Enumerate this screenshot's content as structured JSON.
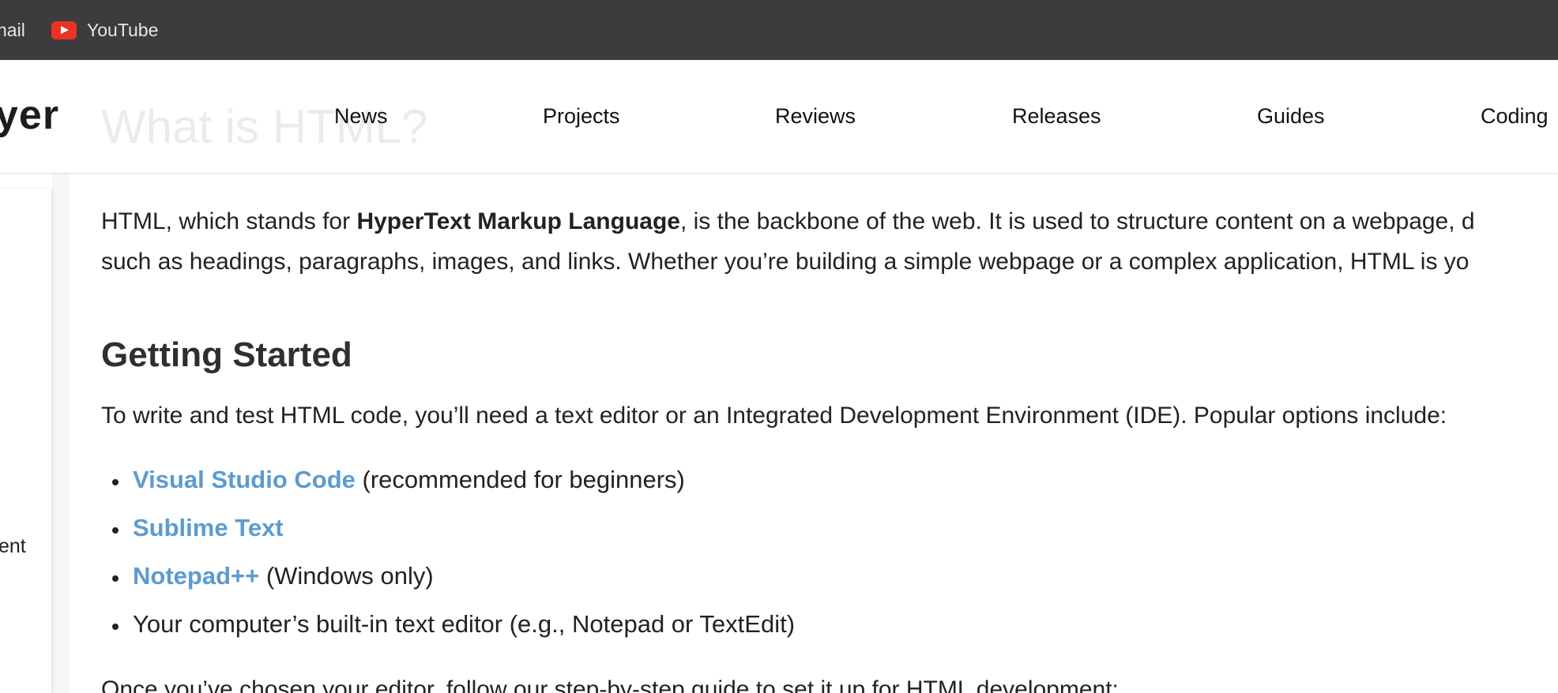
{
  "bookmarks": {
    "items": [
      {
        "label": "Gmail",
        "icon": "gmail-icon"
      },
      {
        "label": "YouTube",
        "icon": "youtube-icon"
      }
    ],
    "visible_gmail_fragment": "nail"
  },
  "header": {
    "logo_text": "yer",
    "ghost_title": "What is HTML?",
    "nav": [
      "News",
      "Projects",
      "Reviews",
      "Releases",
      "Guides",
      "Coding"
    ]
  },
  "sidebar": {
    "item_fragment": "ent"
  },
  "article": {
    "intro_part1": "HTML, which stands for ",
    "intro_bold": "HyperText Markup Language",
    "intro_part2": ", is the backbone of the web. It is used to structure content on a webpage, d",
    "intro_line2": "such as headings, paragraphs, images, and links. Whether you’re building a simple webpage or a complex application, HTML is yo",
    "heading": "Getting Started",
    "lead": "To write and test HTML code, you’ll need a text editor or an Integrated Development Environment (IDE). Popular options include:",
    "editors": [
      {
        "name": "Visual Studio Code",
        "note": " (recommended for beginners)"
      },
      {
        "name": "Sublime Text",
        "note": ""
      },
      {
        "name": "Notepad++",
        "note": " (Windows only)"
      }
    ],
    "builtin_editor": "Your computer’s built-in text editor (e.g., Notepad or TextEdit)",
    "trailing": "Once you’ve chosen your editor, follow our step-by-step guide to set it up for HTML development:"
  },
  "colors": {
    "bookmarks_bar": "#3c3c3c",
    "link": "#5b9bd0",
    "youtube_red": "#ea3323"
  }
}
